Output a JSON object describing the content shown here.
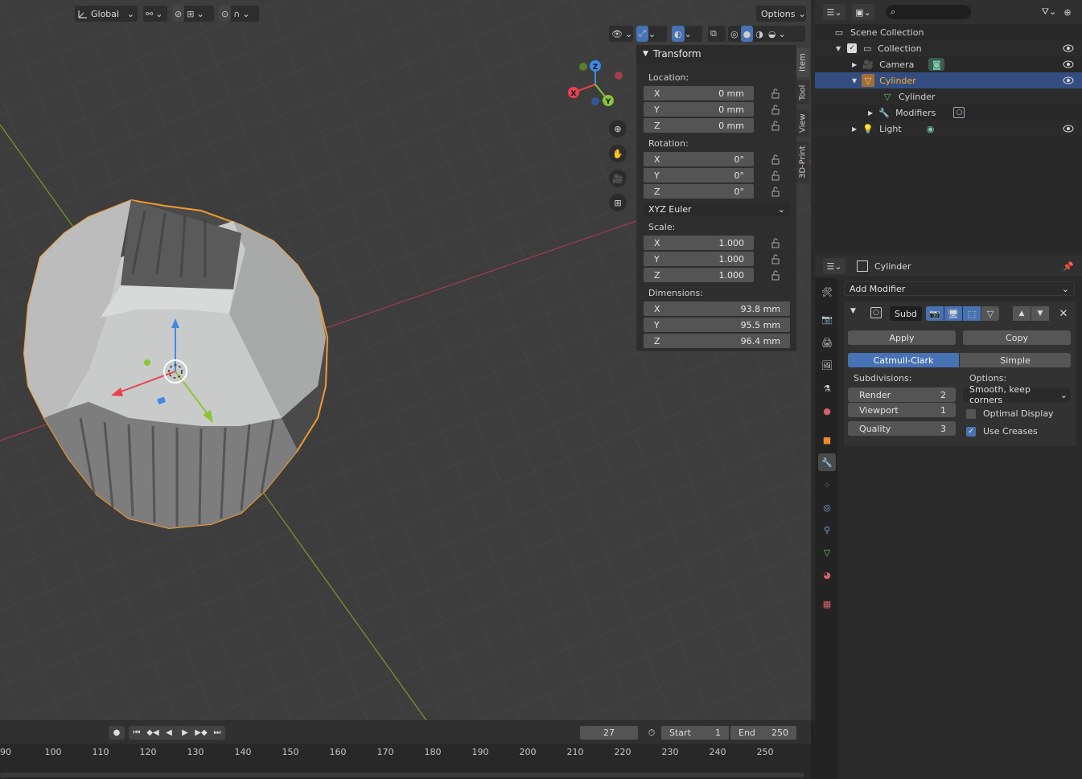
{
  "header": {
    "orientation_label": "Global",
    "options_label": "Options"
  },
  "npanel": {
    "title": "Transform",
    "location_label": "Location:",
    "location": [
      {
        "axis": "X",
        "value": "0 mm"
      },
      {
        "axis": "Y",
        "value": "0 mm"
      },
      {
        "axis": "Z",
        "value": "0 mm"
      }
    ],
    "rotation_label": "Rotation:",
    "rotation": [
      {
        "axis": "X",
        "value": "0°"
      },
      {
        "axis": "Y",
        "value": "0°"
      },
      {
        "axis": "Z",
        "value": "0°"
      }
    ],
    "rotation_mode": "XYZ Euler",
    "scale_label": "Scale:",
    "scale": [
      {
        "axis": "X",
        "value": "1.000"
      },
      {
        "axis": "Y",
        "value": "1.000"
      },
      {
        "axis": "Z",
        "value": "1.000"
      }
    ],
    "dimensions_label": "Dimensions:",
    "dimensions": [
      {
        "axis": "X",
        "value": "93.8 mm"
      },
      {
        "axis": "Y",
        "value": "95.5 mm"
      },
      {
        "axis": "Z",
        "value": "96.4 mm"
      }
    ],
    "tabs": [
      "Item",
      "Tool",
      "View",
      "3D-Print"
    ]
  },
  "gizmo": {
    "x": "X",
    "y": "Y",
    "z": "Z"
  },
  "outliner": {
    "items": [
      {
        "label": "Scene Collection"
      },
      {
        "label": "Collection"
      },
      {
        "label": "Camera"
      },
      {
        "label": "Cylinder"
      },
      {
        "label": "Cylinder"
      },
      {
        "label": "Modifiers"
      },
      {
        "label": "Light"
      }
    ]
  },
  "properties": {
    "object_name": "Cylinder",
    "add_modifier": "Add Modifier",
    "modifier_name": "Subd",
    "apply": "Apply",
    "copy": "Copy",
    "algo_catmull": "Catmull-Clark",
    "algo_simple": "Simple",
    "subdivisions_label": "Subdivisions:",
    "options_label": "Options:",
    "render_label": "Render",
    "render_value": "2",
    "viewport_label": "Viewport",
    "viewport_value": "1",
    "quality_label": "Quality",
    "quality_value": "3",
    "uv_smooth": "Smooth, keep corners",
    "optimal_display": "Optimal Display",
    "optimal_display_checked": false,
    "use_creases": "Use Creases",
    "use_creases_checked": true
  },
  "timeline": {
    "current_frame": "27",
    "start_label": "Start",
    "start_value": "1",
    "end_label": "End",
    "end_value": "250",
    "ticks": [
      "90",
      "100",
      "110",
      "120",
      "130",
      "140",
      "150",
      "160",
      "170",
      "180",
      "190",
      "200",
      "210",
      "220",
      "230",
      "240",
      "250"
    ]
  },
  "colors": {
    "accent": "#4772b3",
    "selection_outline": "#f29a2e",
    "x_axis": "#e8414f",
    "y_axis": "#8bc436",
    "z_axis": "#3f8ae8"
  }
}
